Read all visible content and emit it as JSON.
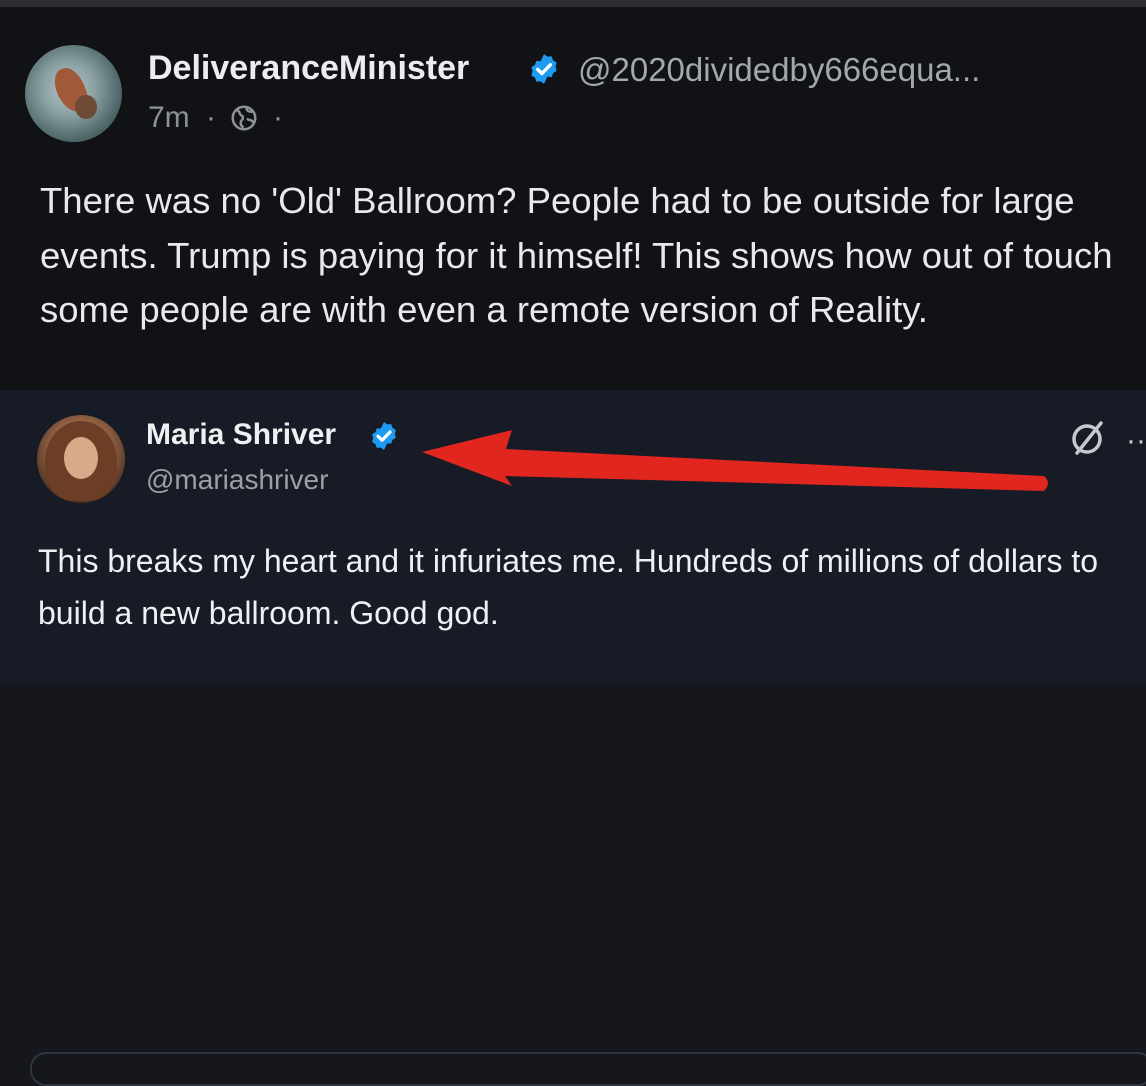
{
  "post": {
    "author_name": "DeliveranceMinister",
    "author_handle": "@2020dividedby666equa...",
    "time": "7m",
    "separator": "·",
    "text": "There was no 'Old' Ballroom? People had to be outside for large events. Trump is paying for it himself! This shows how out of touch some people are with even a remote version of Reality."
  },
  "embed": {
    "author_name": "Maria Shriver",
    "author_handle": "@mariashriver",
    "text": "This breaks my heart and it infuriates me. Hundreds of millions of dollars to build a new ballroom. Good god.",
    "more": "··"
  },
  "colors": {
    "verified": "#1d9bf0",
    "arrow": "#e0261f"
  },
  "icons": [
    "verified-badge-icon",
    "globe-icon",
    "slash-icon",
    "more-icon"
  ]
}
